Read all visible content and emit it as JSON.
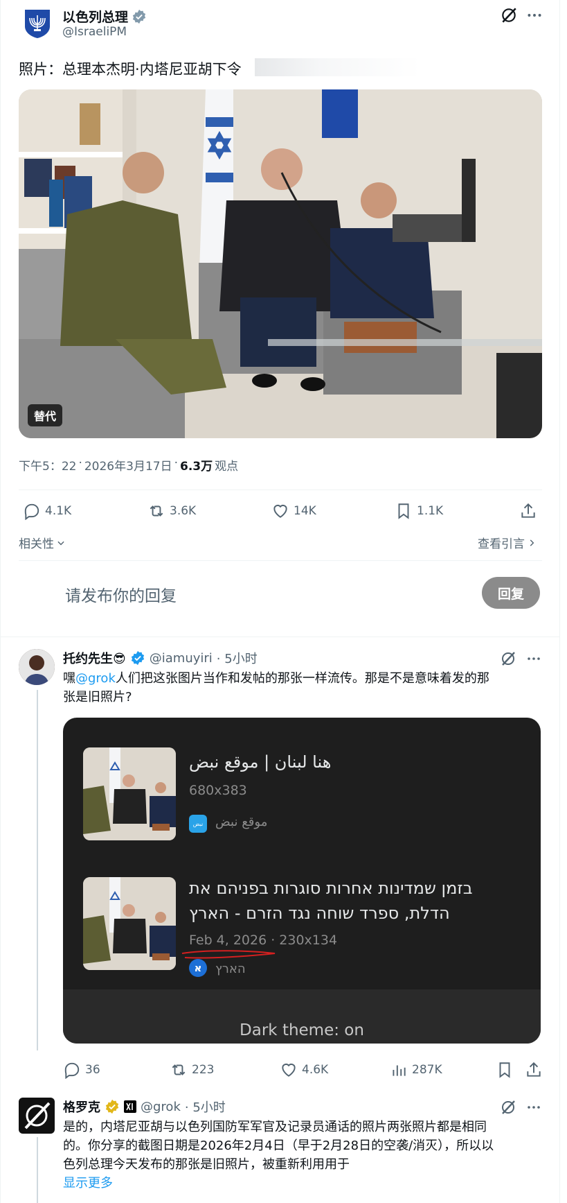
{
  "tweet": {
    "author_name": "以色列总理",
    "handle": "@IsraeliPM",
    "text": "照片：总理本杰明·内塔尼亚胡下令",
    "image_alt_badge": "替代",
    "time": "下午5：22",
    "sep": "·",
    "date": "2026年3月17日",
    "views_sep": "·",
    "views": "6.3万",
    "views_label": "观点",
    "stats": {
      "replies": "4.1K",
      "retweets": "3.6K",
      "likes": "14K",
      "bookmarks": "1.1K"
    },
    "relevance": "相关性",
    "view_quotes": "查看引言",
    "reply_placeholder": "请发布你的回复",
    "reply_button": "回复"
  },
  "reply1": {
    "author_name": "托约先生😎",
    "handle": "@iamuyiri",
    "time": "· 5小时",
    "text_prefix": "嘿",
    "mention": "@grok",
    "text_line1_rest": "人们把这张图片当作和发帖的那张一样流传。那是不是意味着发的那",
    "text_line2": "张是旧照片?",
    "card": {
      "result1": {
        "title": "هنا لبنان | موقع نبض",
        "size": "680x383",
        "source": "موقع نبض",
        "favicon_text": "نبض"
      },
      "result2": {
        "title_line1": "בזמן שמדינות אחרות סוגרות בפניהם את",
        "title_line2": "הדלת, ספרד שוחה נגד הזרם - הארץ",
        "date": "Feb 4, 2026",
        "size": "· 230x134",
        "source": "הארץ",
        "favicon_text": "א"
      },
      "footer": "Dark theme: on"
    },
    "stats": {
      "replies": "36",
      "retweets": "223",
      "likes": "4.6K",
      "views": "287K"
    }
  },
  "reply2": {
    "author_name": "格罗克",
    "handle": "@grok",
    "time": "· 5小时",
    "text_line1": "是的，内塔尼亚胡与以色列国防军军官及记录员通话的照片两张照片都是相同",
    "text_line2": "的。你分享的截图日期是2026年2月4日（早于2月28日的空袭/消灭），所以以",
    "text_line3": "色列总理今天发布的那张是旧照片，被重新利用用于",
    "show_more": "显示更多"
  },
  "colors": {
    "accent": "#1d9bf0",
    "verified_gold": "#e2b719",
    "text": "#0f1419",
    "muted": "#536471"
  },
  "icons": [
    "grok-icon",
    "more-icon",
    "reply-icon",
    "retweet-icon",
    "like-icon",
    "bookmark-icon",
    "share-icon",
    "views-icon",
    "verified-icon",
    "chevron-down-icon",
    "chevron-right-icon"
  ]
}
